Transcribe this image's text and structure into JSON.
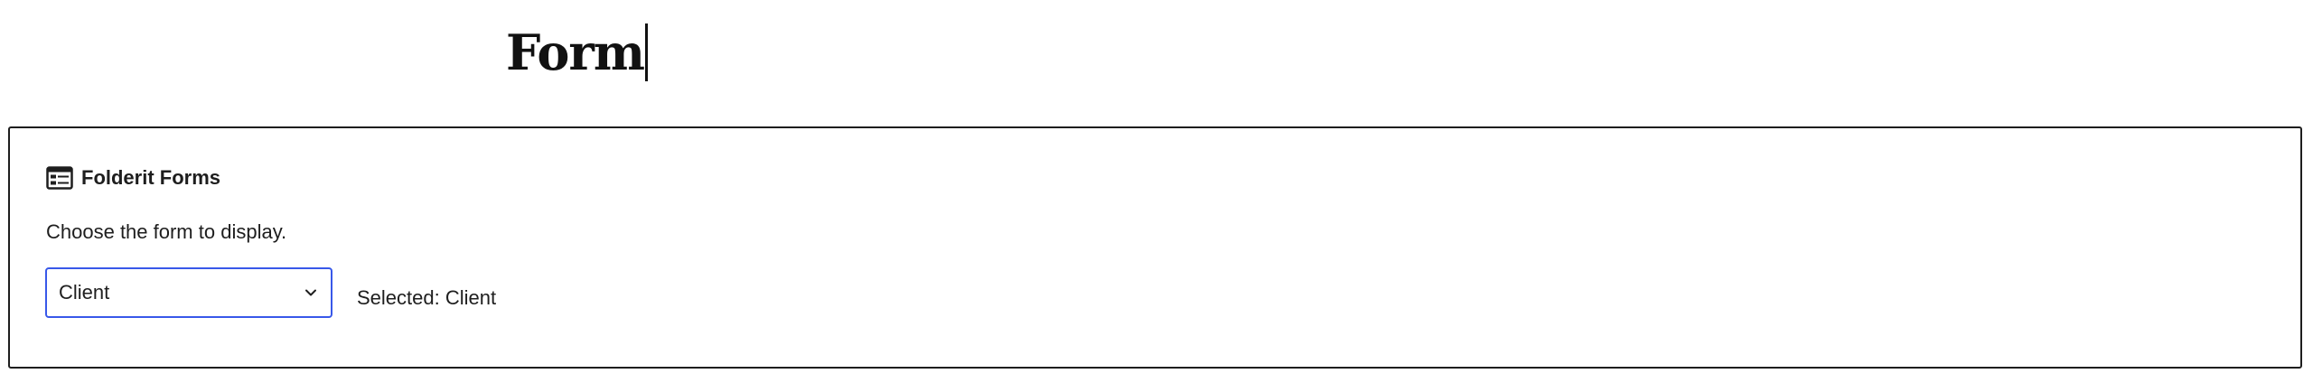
{
  "post": {
    "title": "Form"
  },
  "block": {
    "icon": "form-icon",
    "title": "Folderit Forms",
    "description": "Choose the form to display.",
    "select": {
      "value": "Client",
      "icon": "chevron-down-icon"
    },
    "selected_label": "Selected: Client"
  },
  "colors": {
    "accent": "#3858e9",
    "text": "#1e1e1e",
    "border": "#1e1e1e"
  }
}
